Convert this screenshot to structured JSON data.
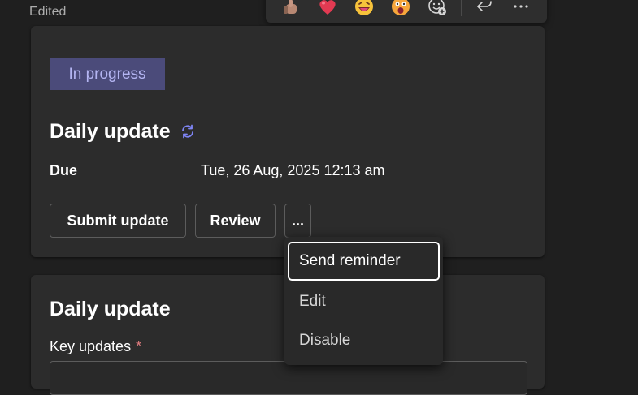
{
  "message": {
    "edited_label": "Edited"
  },
  "reactions": [
    {
      "name": "like",
      "icon": "thumbs-up-icon"
    },
    {
      "name": "heart",
      "icon": "heart-icon"
    },
    {
      "name": "laugh",
      "icon": "laughing-face-icon"
    },
    {
      "name": "surprised",
      "icon": "surprised-face-icon"
    },
    {
      "name": "add-reaction",
      "icon": "add-reaction-icon"
    },
    {
      "name": "reply",
      "icon": "reply-icon"
    },
    {
      "name": "more-options",
      "icon": "more-options-icon"
    }
  ],
  "task_card": {
    "status": "In progress",
    "title": "Daily update",
    "recurring_icon": "recurring-icon",
    "due_label": "Due",
    "due_value": "Tue, 26 Aug, 2025 12:13 am",
    "buttons": {
      "submit": "Submit update",
      "review": "Review",
      "more": "..."
    }
  },
  "form_card": {
    "title": "Daily update",
    "key_updates_label": "Key updates",
    "required_marker": "*",
    "key_updates_value": ""
  },
  "more_menu": {
    "items": [
      {
        "label": "Send reminder",
        "focused": true
      },
      {
        "label": "Edit"
      },
      {
        "label": "Disable"
      }
    ]
  },
  "colors": {
    "background": "#1f1f1f",
    "card": "#2c2c2c",
    "badge_bg": "#4b4b7a",
    "badge_text": "#b4b5f2",
    "accent": "#7f85f5",
    "required": "#e37d80"
  }
}
